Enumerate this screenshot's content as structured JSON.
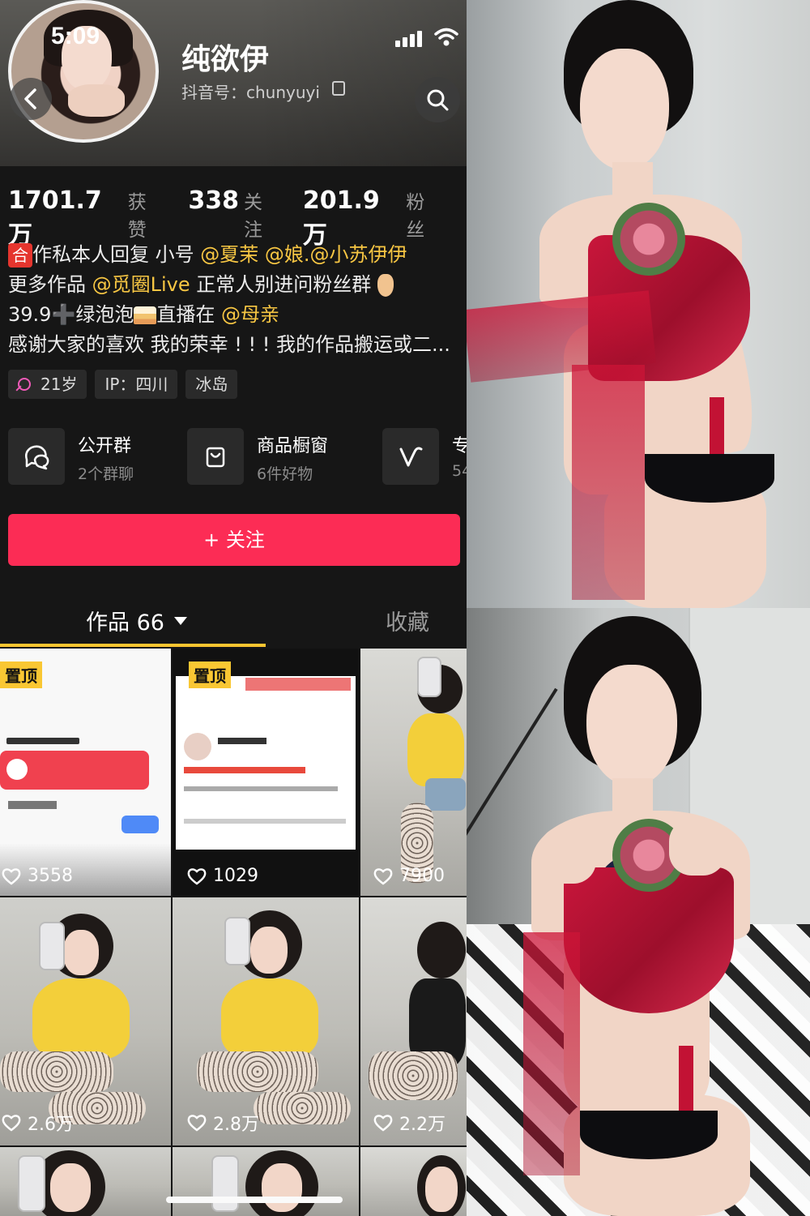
{
  "status_bar": {
    "time": "5:09"
  },
  "profile": {
    "name": "纯欲伊",
    "douyin_id": "抖音号：chunyuyi",
    "stats": [
      {
        "value": "1701.7万",
        "label": "获赞"
      },
      {
        "value": "338",
        "label": "关注"
      },
      {
        "value": "201.9万",
        "label": "粉丝"
      }
    ],
    "bio": {
      "line1": {
        "badge": "合",
        "text": "作私本人回复   小号 ",
        "m1": "@夏茉",
        "sep": " ",
        "m2": "@娘.@小苏伊伊"
      },
      "line2": {
        "text": "更多作品 ",
        "m1": "@觅圈Live",
        "text2": "  正常人别进问粉丝群"
      },
      "line3": {
        "text": "39.9",
        "plus": "➕",
        "text2": "绿泡泡",
        "text3": "直播在 ",
        "m1": "@母亲"
      },
      "line4": "感谢大家的喜欢 我的荣幸 ! ! ! 我的作品搬运或二..."
    },
    "tags": [
      "21岁",
      "IP：四川",
      "冰岛"
    ],
    "shortcuts": [
      {
        "title": "公开群",
        "sub": "2个群聊",
        "icon": "chat-bubbles-icon"
      },
      {
        "title": "商品橱窗",
        "sub": "6件好物",
        "icon": "shopping-bag-icon"
      },
      {
        "title": "专",
        "sub": "54",
        "icon": "v-logo-icon"
      }
    ],
    "follow_label": "+ 关注"
  },
  "tabs": {
    "works": "作品 66",
    "favorites": "收藏"
  },
  "grid": {
    "pinned_label": "置顶",
    "tiles": [
      {
        "likes": "3558",
        "pinned": true
      },
      {
        "likes": "1029",
        "pinned": true
      },
      {
        "likes": "7900",
        "pinned": false
      },
      {
        "likes": "2.6万",
        "pinned": false
      },
      {
        "likes": "2.8万",
        "pinned": false
      },
      {
        "likes": "2.2万",
        "pinned": false
      }
    ]
  },
  "colors": {
    "follow": "#fc2c55",
    "mention": "#f7c643",
    "pin": "#f9c733",
    "tab_indicator": "#fac530"
  }
}
